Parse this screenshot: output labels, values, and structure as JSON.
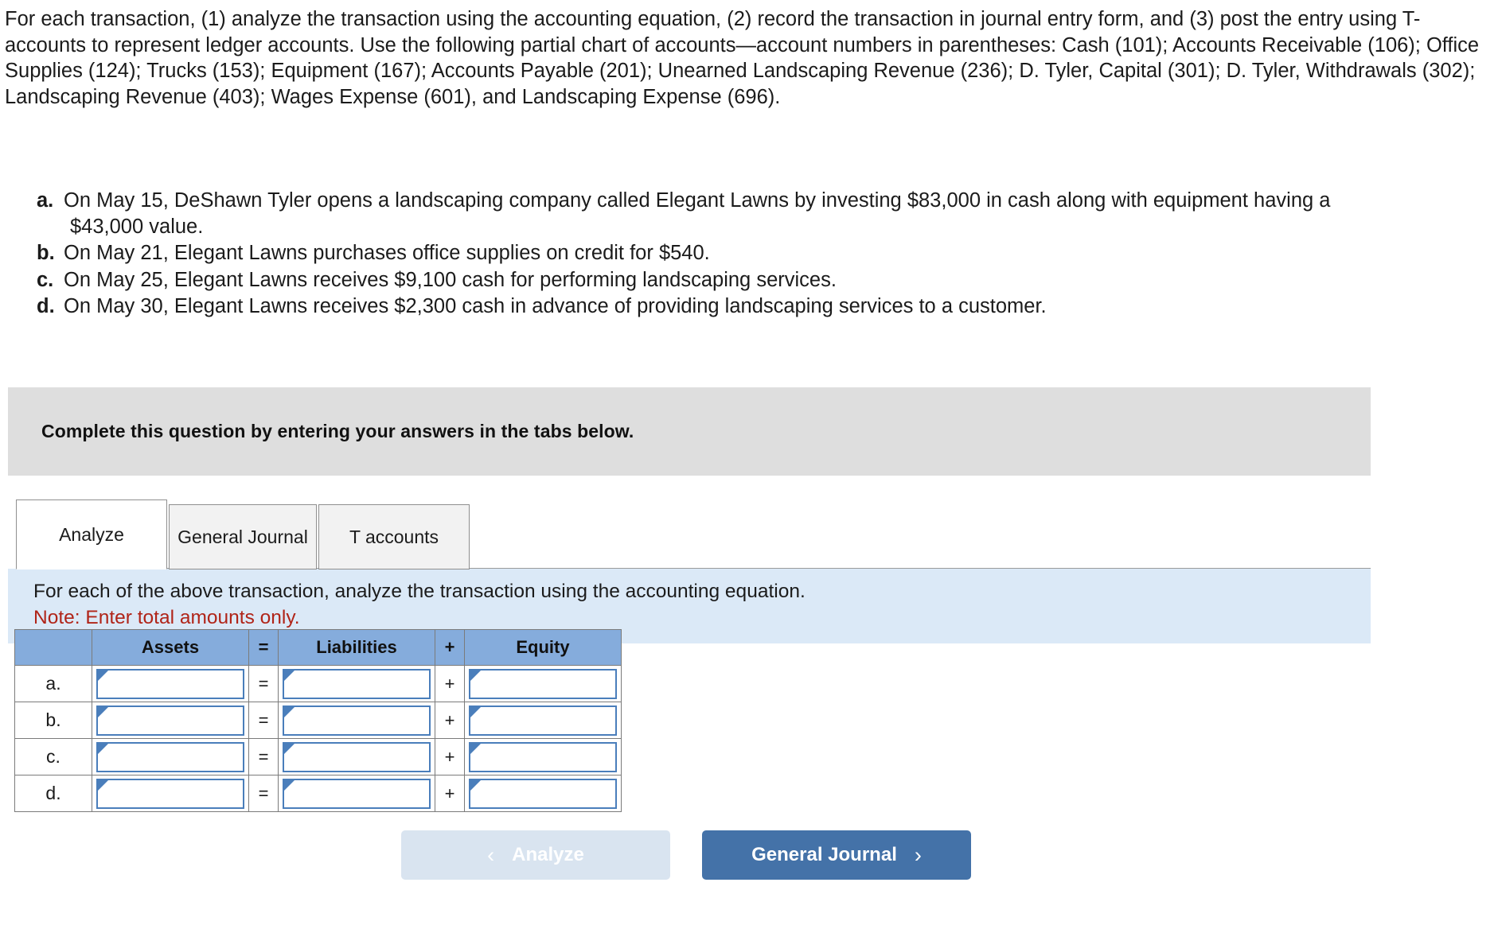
{
  "problem": {
    "intro": "For each transaction, (1) analyze the transaction using the accounting equation, (2) record the transaction in journal entry form, and (3) post the entry using T-accounts to represent ledger accounts. Use the following partial chart of accounts—account numbers in parentheses: Cash (101); Accounts Receivable (106); Office Supplies (124); Trucks (153); Equipment (167); Accounts Payable (201); Unearned Landscaping Revenue (236); D. Tyler, Capital (301); D. Tyler, Withdrawals (302); Landscaping Revenue (403); Wages Expense (601), and Landscaping Expense (696).",
    "transactions": [
      {
        "letter": "a.",
        "text": "On May 15, DeShawn Tyler opens a landscaping company called Elegant Lawns by investing $83,000 in cash along with equipment having a $43,000 value."
      },
      {
        "letter": "b.",
        "text": "On May 21, Elegant Lawns purchases office supplies on credit for $540."
      },
      {
        "letter": "c.",
        "text": "On May 25, Elegant Lawns receives $9,100 cash for performing landscaping services."
      },
      {
        "letter": "d.",
        "text": "On May 30, Elegant Lawns receives $2,300 cash in advance of providing landscaping services to a customer."
      }
    ]
  },
  "banner": {
    "text": "Complete this question by entering your answers in the tabs below."
  },
  "tabs": [
    {
      "label": "Analyze",
      "active": true
    },
    {
      "label": "General Journal",
      "active": false
    },
    {
      "label": "T accounts",
      "active": false
    }
  ],
  "note": {
    "instruction": "For each of the above transaction, analyze the transaction using the accounting equation.",
    "warning": "Note: Enter total amounts only.",
    "warning_color": "#b02418"
  },
  "table": {
    "headers": [
      "",
      "Assets",
      "=",
      "Liabilities",
      "+",
      "Equity"
    ],
    "header_bg": "#85acdc",
    "rows": [
      {
        "label": "a.",
        "assets": "",
        "op1": "=",
        "liabilities": "",
        "op2": "+",
        "equity": ""
      },
      {
        "label": "b.",
        "assets": "",
        "op1": "=",
        "liabilities": "",
        "op2": "+",
        "equity": ""
      },
      {
        "label": "c.",
        "assets": "",
        "op1": "=",
        "liabilities": "",
        "op2": "+",
        "equity": ""
      },
      {
        "label": "d.",
        "assets": "",
        "op1": "=",
        "liabilities": "",
        "op2": "+",
        "equity": ""
      }
    ]
  },
  "nav": {
    "prev_label": "Analyze",
    "prev_chevron": "‹",
    "next_label": "General Journal",
    "next_chevron": "›",
    "next_bg": "#4472a8",
    "prev_bg": "#d9e4f0"
  }
}
